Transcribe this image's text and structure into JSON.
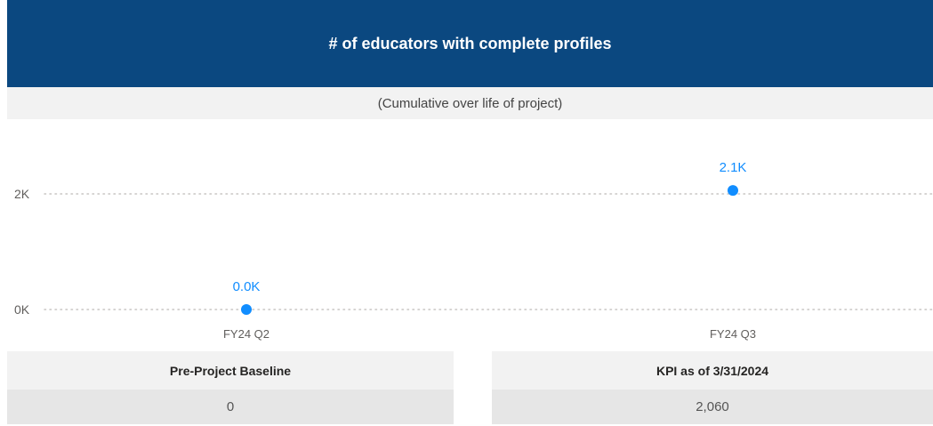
{
  "header": {
    "title": "# of educators with complete profiles",
    "subtitle": "(Cumulative over life of project)"
  },
  "chart_data": {
    "type": "line",
    "categories": [
      "FY24 Q2",
      "FY24 Q3"
    ],
    "series": [
      {
        "values": [
          0,
          2060
        ],
        "labels": [
          "0.0K",
          "2.1K"
        ],
        "color": "#118dff"
      }
    ],
    "y_ticks": [
      {
        "value": 0,
        "label": "0K"
      },
      {
        "value": 2000,
        "label": "2K"
      }
    ],
    "ylim": [
      0,
      2000
    ],
    "grid": true,
    "colors": {
      "gridline": "#c8c6c4",
      "axis_text": "#605e5c"
    }
  },
  "kpis": [
    {
      "label": "Pre-Project Baseline",
      "value": "0"
    },
    {
      "label": "KPI as of 3/31/2024",
      "value": "2,060"
    }
  ]
}
